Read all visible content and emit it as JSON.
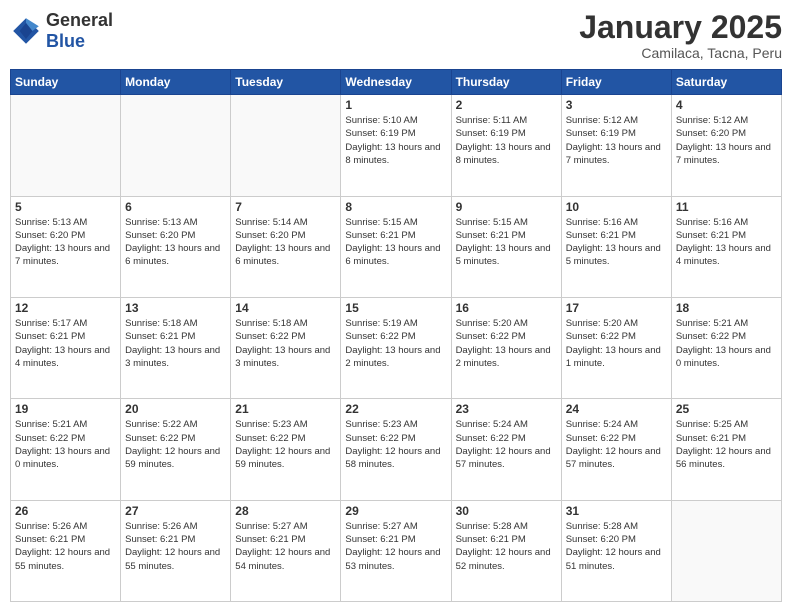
{
  "header": {
    "logo_general": "General",
    "logo_blue": "Blue",
    "month_title": "January 2025",
    "location": "Camilaca, Tacna, Peru"
  },
  "weekdays": [
    "Sunday",
    "Monday",
    "Tuesday",
    "Wednesday",
    "Thursday",
    "Friday",
    "Saturday"
  ],
  "weeks": [
    [
      {
        "day": "",
        "info": ""
      },
      {
        "day": "",
        "info": ""
      },
      {
        "day": "",
        "info": ""
      },
      {
        "day": "1",
        "info": "Sunrise: 5:10 AM\nSunset: 6:19 PM\nDaylight: 13 hours\nand 8 minutes."
      },
      {
        "day": "2",
        "info": "Sunrise: 5:11 AM\nSunset: 6:19 PM\nDaylight: 13 hours\nand 8 minutes."
      },
      {
        "day": "3",
        "info": "Sunrise: 5:12 AM\nSunset: 6:19 PM\nDaylight: 13 hours\nand 7 minutes."
      },
      {
        "day": "4",
        "info": "Sunrise: 5:12 AM\nSunset: 6:20 PM\nDaylight: 13 hours\nand 7 minutes."
      }
    ],
    [
      {
        "day": "5",
        "info": "Sunrise: 5:13 AM\nSunset: 6:20 PM\nDaylight: 13 hours\nand 7 minutes."
      },
      {
        "day": "6",
        "info": "Sunrise: 5:13 AM\nSunset: 6:20 PM\nDaylight: 13 hours\nand 6 minutes."
      },
      {
        "day": "7",
        "info": "Sunrise: 5:14 AM\nSunset: 6:20 PM\nDaylight: 13 hours\nand 6 minutes."
      },
      {
        "day": "8",
        "info": "Sunrise: 5:15 AM\nSunset: 6:21 PM\nDaylight: 13 hours\nand 6 minutes."
      },
      {
        "day": "9",
        "info": "Sunrise: 5:15 AM\nSunset: 6:21 PM\nDaylight: 13 hours\nand 5 minutes."
      },
      {
        "day": "10",
        "info": "Sunrise: 5:16 AM\nSunset: 6:21 PM\nDaylight: 13 hours\nand 5 minutes."
      },
      {
        "day": "11",
        "info": "Sunrise: 5:16 AM\nSunset: 6:21 PM\nDaylight: 13 hours\nand 4 minutes."
      }
    ],
    [
      {
        "day": "12",
        "info": "Sunrise: 5:17 AM\nSunset: 6:21 PM\nDaylight: 13 hours\nand 4 minutes."
      },
      {
        "day": "13",
        "info": "Sunrise: 5:18 AM\nSunset: 6:21 PM\nDaylight: 13 hours\nand 3 minutes."
      },
      {
        "day": "14",
        "info": "Sunrise: 5:18 AM\nSunset: 6:22 PM\nDaylight: 13 hours\nand 3 minutes."
      },
      {
        "day": "15",
        "info": "Sunrise: 5:19 AM\nSunset: 6:22 PM\nDaylight: 13 hours\nand 2 minutes."
      },
      {
        "day": "16",
        "info": "Sunrise: 5:20 AM\nSunset: 6:22 PM\nDaylight: 13 hours\nand 2 minutes."
      },
      {
        "day": "17",
        "info": "Sunrise: 5:20 AM\nSunset: 6:22 PM\nDaylight: 13 hours\nand 1 minute."
      },
      {
        "day": "18",
        "info": "Sunrise: 5:21 AM\nSunset: 6:22 PM\nDaylight: 13 hours\nand 0 minutes."
      }
    ],
    [
      {
        "day": "19",
        "info": "Sunrise: 5:21 AM\nSunset: 6:22 PM\nDaylight: 13 hours\nand 0 minutes."
      },
      {
        "day": "20",
        "info": "Sunrise: 5:22 AM\nSunset: 6:22 PM\nDaylight: 12 hours\nand 59 minutes."
      },
      {
        "day": "21",
        "info": "Sunrise: 5:23 AM\nSunset: 6:22 PM\nDaylight: 12 hours\nand 59 minutes."
      },
      {
        "day": "22",
        "info": "Sunrise: 5:23 AM\nSunset: 6:22 PM\nDaylight: 12 hours\nand 58 minutes."
      },
      {
        "day": "23",
        "info": "Sunrise: 5:24 AM\nSunset: 6:22 PM\nDaylight: 12 hours\nand 57 minutes."
      },
      {
        "day": "24",
        "info": "Sunrise: 5:24 AM\nSunset: 6:22 PM\nDaylight: 12 hours\nand 57 minutes."
      },
      {
        "day": "25",
        "info": "Sunrise: 5:25 AM\nSunset: 6:21 PM\nDaylight: 12 hours\nand 56 minutes."
      }
    ],
    [
      {
        "day": "26",
        "info": "Sunrise: 5:26 AM\nSunset: 6:21 PM\nDaylight: 12 hours\nand 55 minutes."
      },
      {
        "day": "27",
        "info": "Sunrise: 5:26 AM\nSunset: 6:21 PM\nDaylight: 12 hours\nand 55 minutes."
      },
      {
        "day": "28",
        "info": "Sunrise: 5:27 AM\nSunset: 6:21 PM\nDaylight: 12 hours\nand 54 minutes."
      },
      {
        "day": "29",
        "info": "Sunrise: 5:27 AM\nSunset: 6:21 PM\nDaylight: 12 hours\nand 53 minutes."
      },
      {
        "day": "30",
        "info": "Sunrise: 5:28 AM\nSunset: 6:21 PM\nDaylight: 12 hours\nand 52 minutes."
      },
      {
        "day": "31",
        "info": "Sunrise: 5:28 AM\nSunset: 6:20 PM\nDaylight: 12 hours\nand 51 minutes."
      },
      {
        "day": "",
        "info": ""
      }
    ]
  ]
}
